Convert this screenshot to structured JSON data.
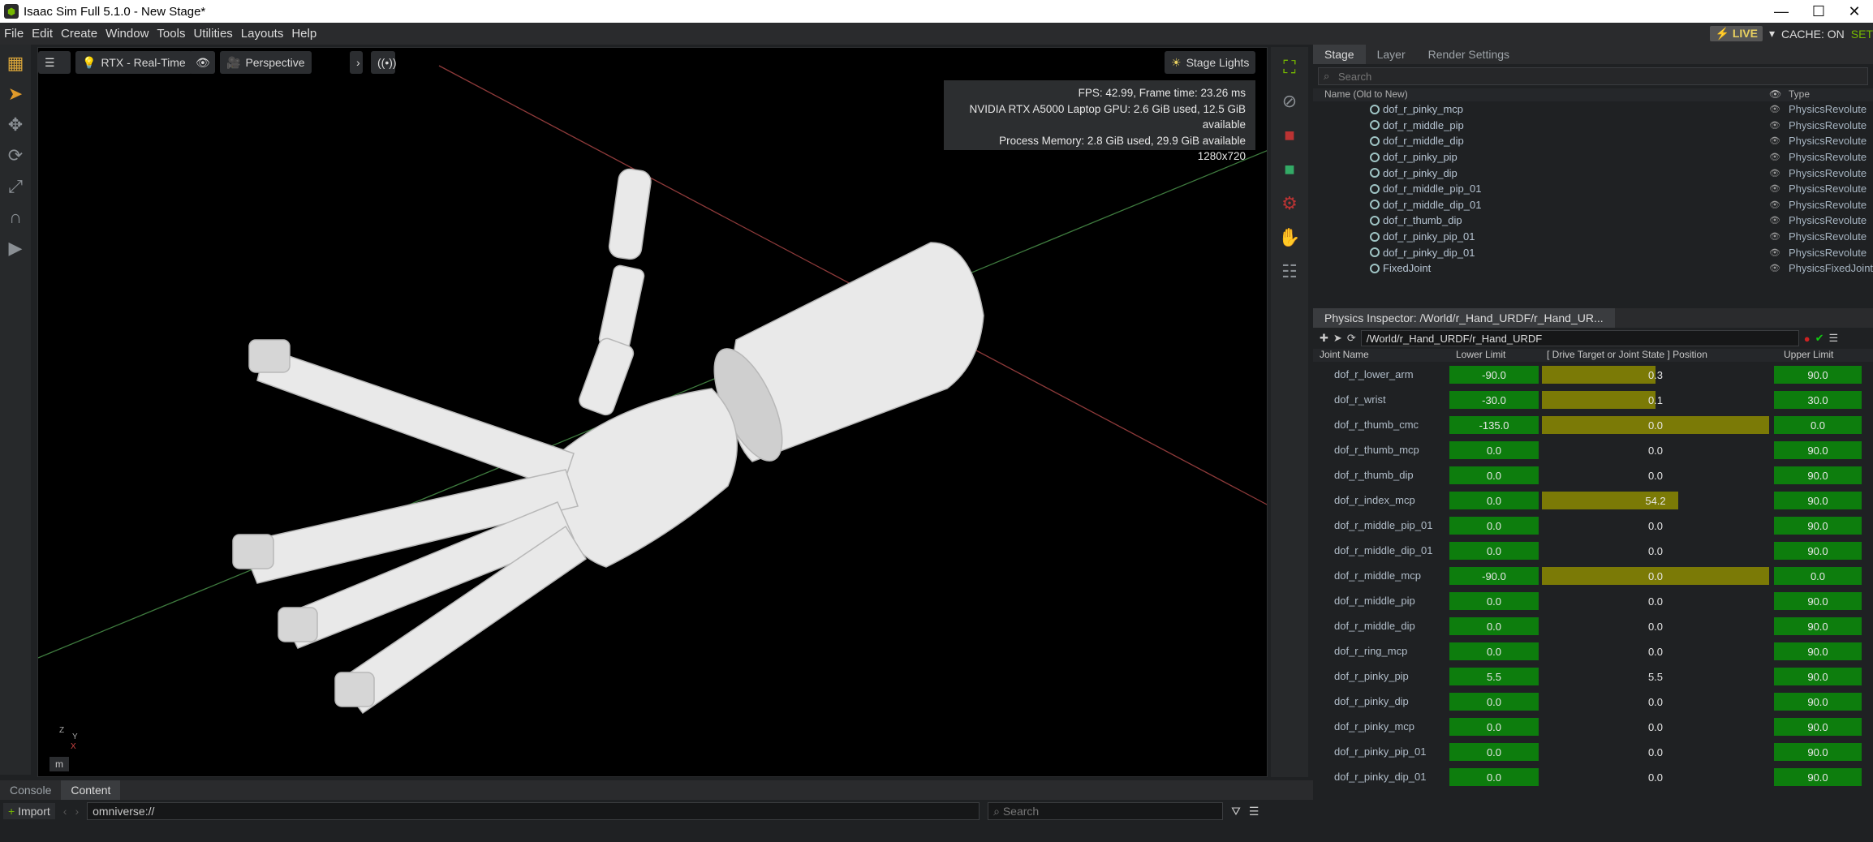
{
  "window": {
    "title": "Isaac Sim Full 5.1.0 - New Stage*",
    "minimize": "—",
    "maximize": "☐",
    "close": "✕"
  },
  "menu": {
    "items": [
      "File",
      "Edit",
      "Create",
      "Window",
      "Tools",
      "Utilities",
      "Layouts",
      "Help"
    ],
    "live": "LIVE",
    "cache": "CACHE: ON",
    "set": "SET"
  },
  "viewport": {
    "renderer": "RTX - Real-Time",
    "camera": "Perspective",
    "lights": "Stage Lights",
    "stats": [
      "FPS: 42.99, Frame time: 23.26 ms",
      "NVIDIA RTX A5000 Laptop GPU: 2.6 GiB used, 12.5 GiB available",
      "Process Memory: 2.8 GiB used, 29.9 GiB available",
      "1280x720"
    ],
    "axis_z": "Z",
    "axis_y": "Y",
    "axis_x": "X",
    "unit": "m"
  },
  "stage": {
    "tabs": [
      "Stage",
      "Layer",
      "Render Settings"
    ],
    "search_placeholder": "Search",
    "col_name": "Name (Old to New)",
    "col_type": "Type",
    "rows": [
      {
        "name": "dof_r_pinky_mcp",
        "type": "PhysicsRevolute"
      },
      {
        "name": "dof_r_middle_pip",
        "type": "PhysicsRevolute"
      },
      {
        "name": "dof_r_middle_dip",
        "type": "PhysicsRevolute"
      },
      {
        "name": "dof_r_pinky_pip",
        "type": "PhysicsRevolute"
      },
      {
        "name": "dof_r_pinky_dip",
        "type": "PhysicsRevolute"
      },
      {
        "name": "dof_r_middle_pip_01",
        "type": "PhysicsRevolute"
      },
      {
        "name": "dof_r_middle_dip_01",
        "type": "PhysicsRevolute"
      },
      {
        "name": "dof_r_thumb_dip",
        "type": "PhysicsRevolute"
      },
      {
        "name": "dof_r_pinky_pip_01",
        "type": "PhysicsRevolute"
      },
      {
        "name": "dof_r_pinky_dip_01",
        "type": "PhysicsRevolute"
      },
      {
        "name": "FixedJoint",
        "type": "PhysicsFixedJoint"
      }
    ]
  },
  "physics": {
    "tab": "Physics Inspector: /World/r_Hand_URDF/r_Hand_UR...",
    "path": "/World/r_Hand_URDF/r_Hand_URDF",
    "headers": {
      "joint": "Joint Name",
      "lower": "Lower Limit",
      "drive": "[ Drive Target or Joint State ] Position",
      "upper": "Upper Limit"
    },
    "joints": [
      {
        "name": "dof_r_lower_arm",
        "lower": "-90.0",
        "pos": "0.3",
        "upper": "90.0",
        "fill": 0.5,
        "green": true
      },
      {
        "name": "dof_r_wrist",
        "lower": "-30.0",
        "pos": "0.1",
        "upper": "30.0",
        "fill": 0.5,
        "green": true
      },
      {
        "name": "dof_r_thumb_cmc",
        "lower": "-135.0",
        "pos": "0.0",
        "upper": "0.0",
        "fill": 1.0,
        "green": true
      },
      {
        "name": "dof_r_thumb_mcp",
        "lower": "0.0",
        "pos": "0.0",
        "upper": "90.0",
        "fill": 0,
        "green": true
      },
      {
        "name": "dof_r_thumb_dip",
        "lower": "0.0",
        "pos": "0.0",
        "upper": "90.0",
        "fill": 0,
        "green": true
      },
      {
        "name": "dof_r_index_mcp",
        "lower": "0.0",
        "pos": "54.2",
        "upper": "90.0",
        "fill": 0.6,
        "green": true
      },
      {
        "name": "dof_r_middle_pip_01",
        "lower": "0.0",
        "pos": "0.0",
        "upper": "90.0",
        "fill": 0,
        "green": true
      },
      {
        "name": "dof_r_middle_dip_01",
        "lower": "0.0",
        "pos": "0.0",
        "upper": "90.0",
        "fill": 0,
        "green": true
      },
      {
        "name": "dof_r_middle_mcp",
        "lower": "-90.0",
        "pos": "0.0",
        "upper": "0.0",
        "fill": 1.0,
        "green": true
      },
      {
        "name": "dof_r_middle_pip",
        "lower": "0.0",
        "pos": "0.0",
        "upper": "90.0",
        "fill": 0,
        "green": true
      },
      {
        "name": "dof_r_middle_dip",
        "lower": "0.0",
        "pos": "0.0",
        "upper": "90.0",
        "fill": 0,
        "green": true
      },
      {
        "name": "dof_r_ring_mcp",
        "lower": "0.0",
        "pos": "0.0",
        "upper": "90.0",
        "fill": 0,
        "green": true
      },
      {
        "name": "dof_r_pinky_pip",
        "lower": "5.5",
        "pos": "5.5",
        "upper": "90.0",
        "fill": 0,
        "green": true
      },
      {
        "name": "dof_r_pinky_dip",
        "lower": "0.0",
        "pos": "0.0",
        "upper": "90.0",
        "fill": 0,
        "green": true
      },
      {
        "name": "dof_r_pinky_mcp",
        "lower": "0.0",
        "pos": "0.0",
        "upper": "90.0",
        "fill": 0,
        "green": true
      },
      {
        "name": "dof_r_pinky_pip_01",
        "lower": "0.0",
        "pos": "0.0",
        "upper": "90.0",
        "fill": 0,
        "green": true
      },
      {
        "name": "dof_r_pinky_dip_01",
        "lower": "0.0",
        "pos": "0.0",
        "upper": "90.0",
        "fill": 0,
        "green": true
      }
    ]
  },
  "bottom": {
    "tabs": [
      "Console",
      "Content"
    ],
    "import": "Import",
    "path": "omniverse://",
    "search_placeholder": "Search"
  }
}
